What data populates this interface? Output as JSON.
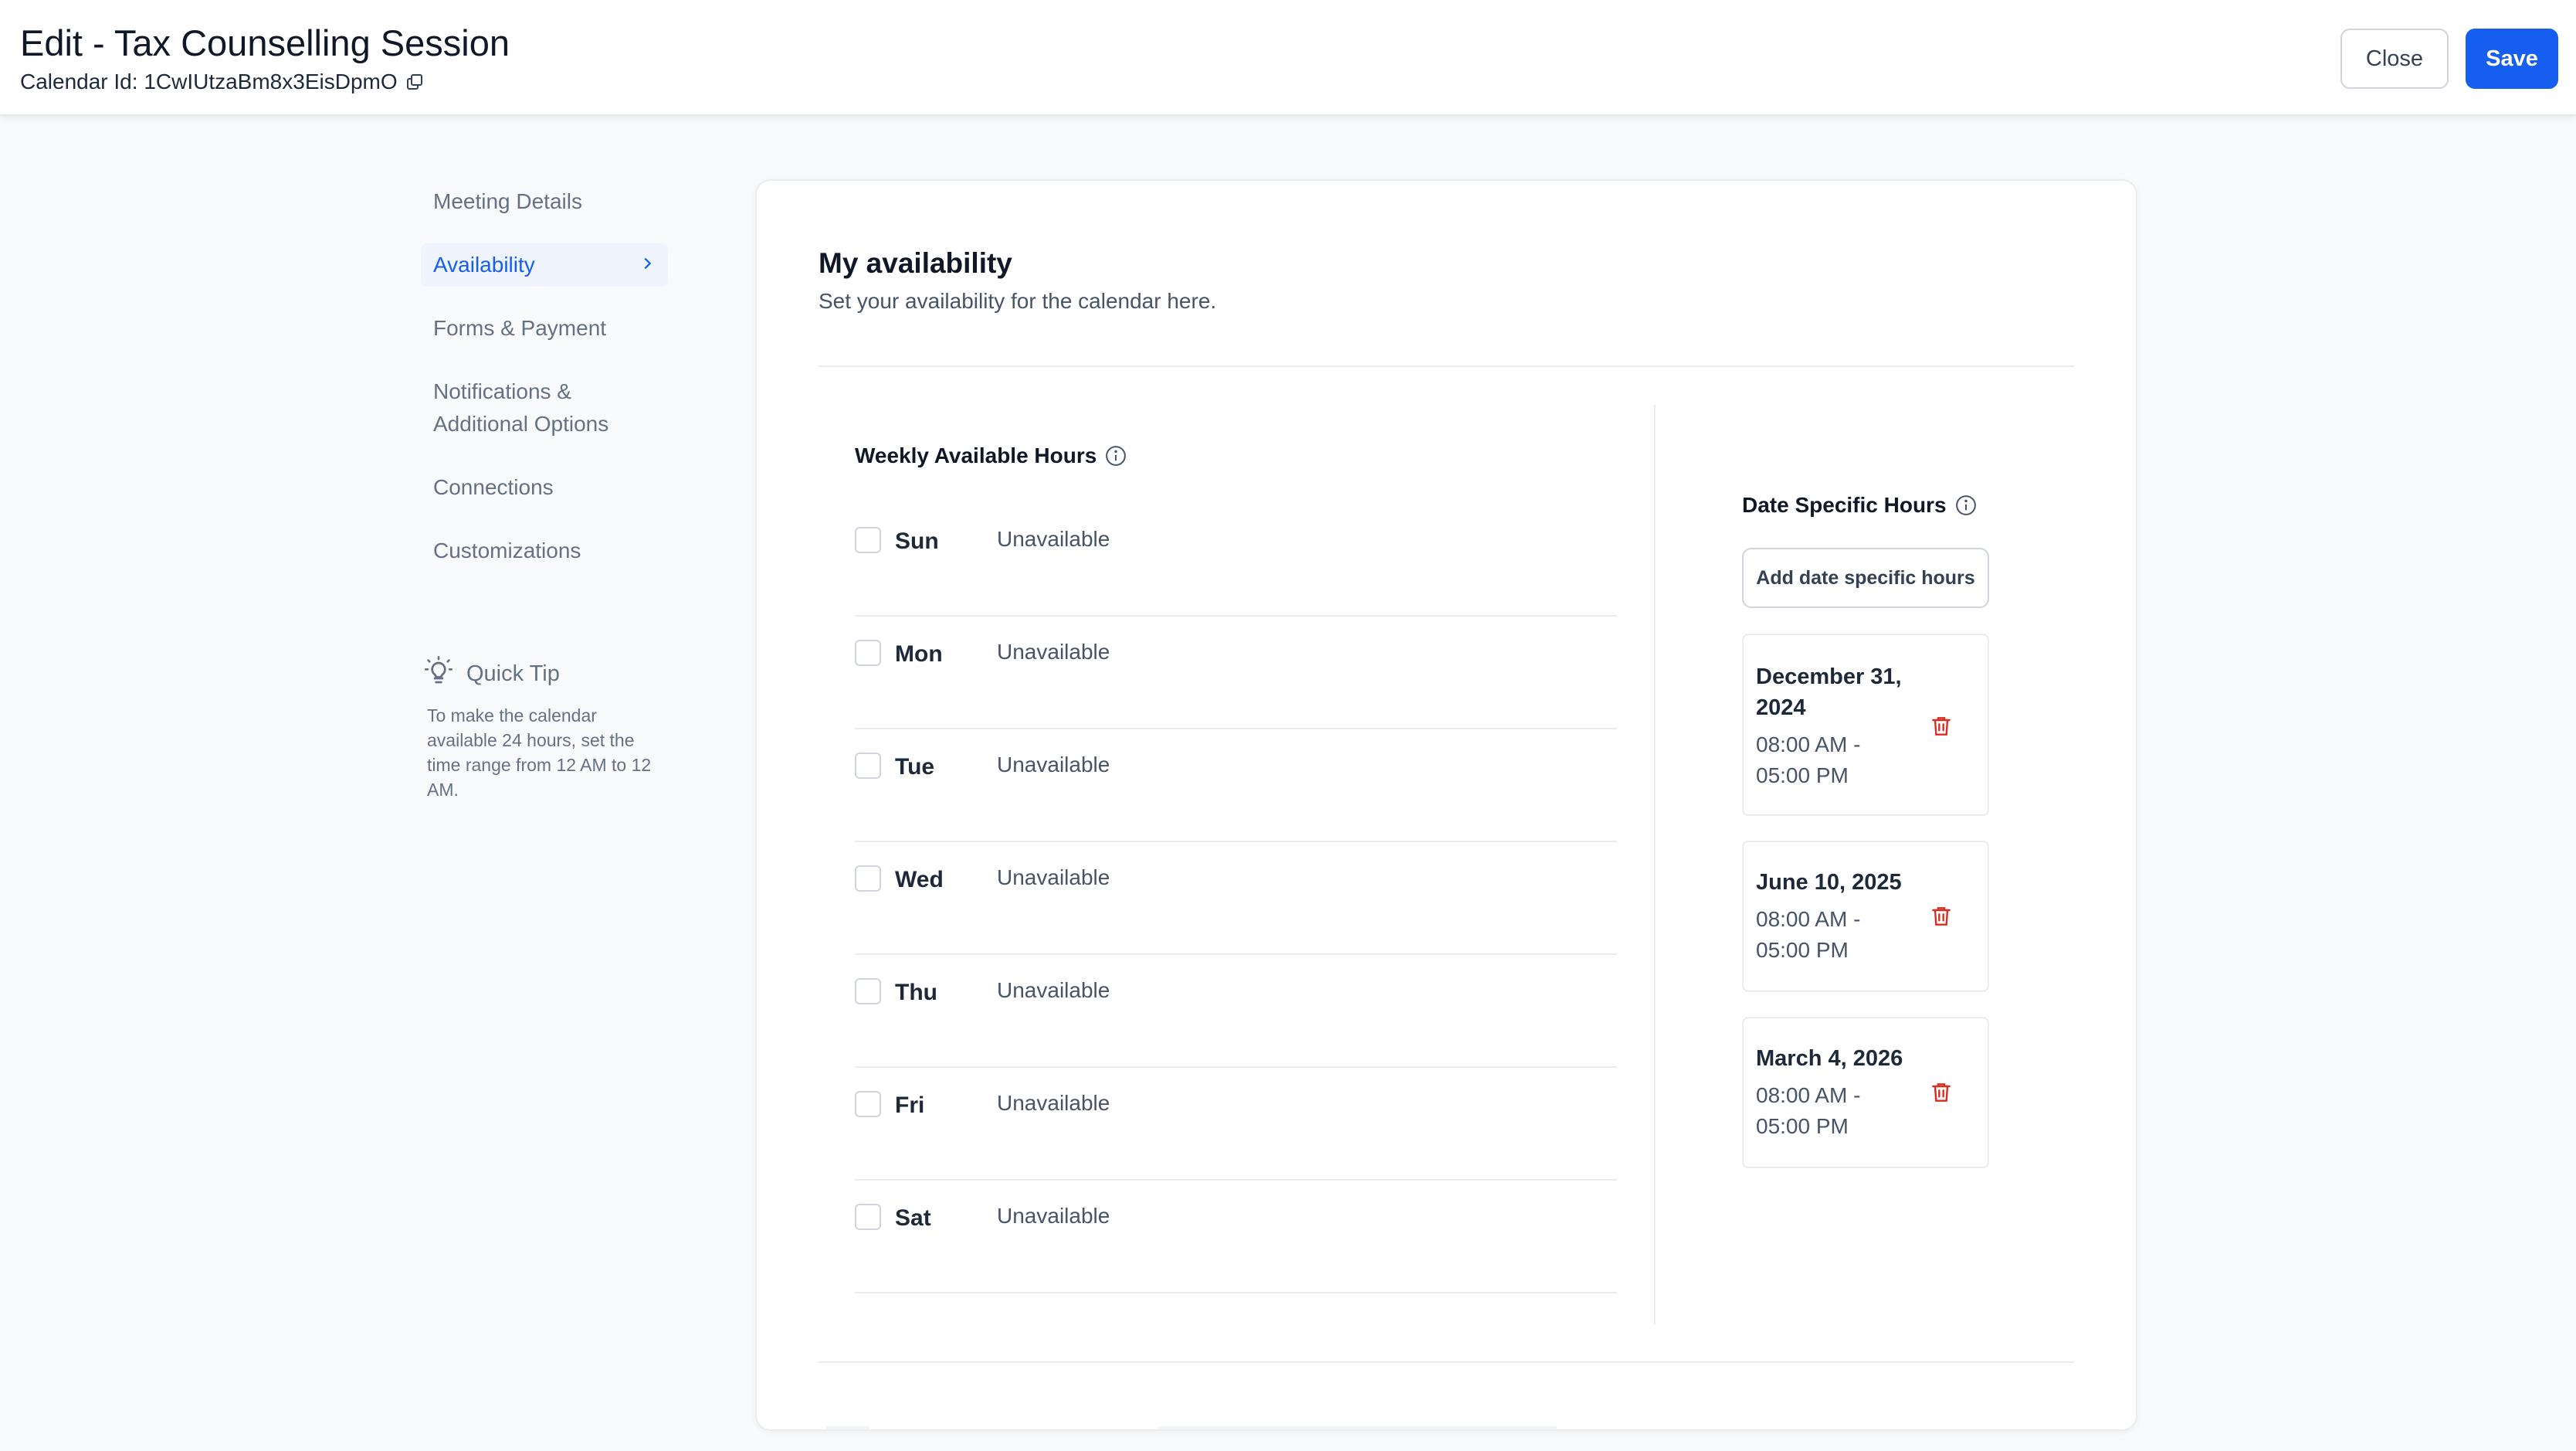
{
  "header": {
    "title": "Edit - Tax Counselling Session",
    "calendar_id_label": "Calendar Id: 1CwIUtzaBm8x3EisDpmO",
    "close_label": "Close",
    "save_label": "Save"
  },
  "sidebar": {
    "items": [
      {
        "label": "Meeting Details"
      },
      {
        "label": "Availability"
      },
      {
        "label": "Forms & Payment"
      },
      {
        "label": "Notifications &"
      },
      {
        "label": "Additional Options"
      },
      {
        "label": "Connections"
      },
      {
        "label": "Customizations"
      }
    ],
    "tip_title": "Quick Tip",
    "tip_text": "To make the calendar available 24 hours, set the time range from 12 AM to 12 AM."
  },
  "main": {
    "title": "My availability",
    "subtitle": "Set your availability for the calendar here.",
    "weekly_title": "Weekly Available Hours",
    "days": [
      {
        "day": "Sun",
        "status": "Unavailable",
        "checked": false
      },
      {
        "day": "Mon",
        "status": "Unavailable",
        "checked": false
      },
      {
        "day": "Tue",
        "status": "Unavailable",
        "checked": false
      },
      {
        "day": "Wed",
        "status": "Unavailable",
        "checked": false
      },
      {
        "day": "Thu",
        "status": "Unavailable",
        "checked": false
      },
      {
        "day": "Fri",
        "status": "Unavailable",
        "checked": false
      },
      {
        "day": "Sat",
        "status": "Unavailable",
        "checked": false
      }
    ],
    "date_specific_title": "Date Specific Hours",
    "add_date_label": "Add date specific hours",
    "date_entries": [
      {
        "date_line1": "December 31,",
        "date_line2": "2024",
        "time_line1": "08:00 AM -",
        "time_line2": "05:00 PM"
      },
      {
        "date_line1": "June 10, 2025",
        "time_line1": "08:00 AM -",
        "time_line2": "05:00 PM"
      },
      {
        "date_line1": "March 4, 2026",
        "time_line1": "08:00 AM -",
        "time_line2": "05:00 PM"
      }
    ]
  },
  "colors": {
    "primary": "#155eef",
    "danger": "#d92d20",
    "active_bg": "#eff4ff"
  }
}
